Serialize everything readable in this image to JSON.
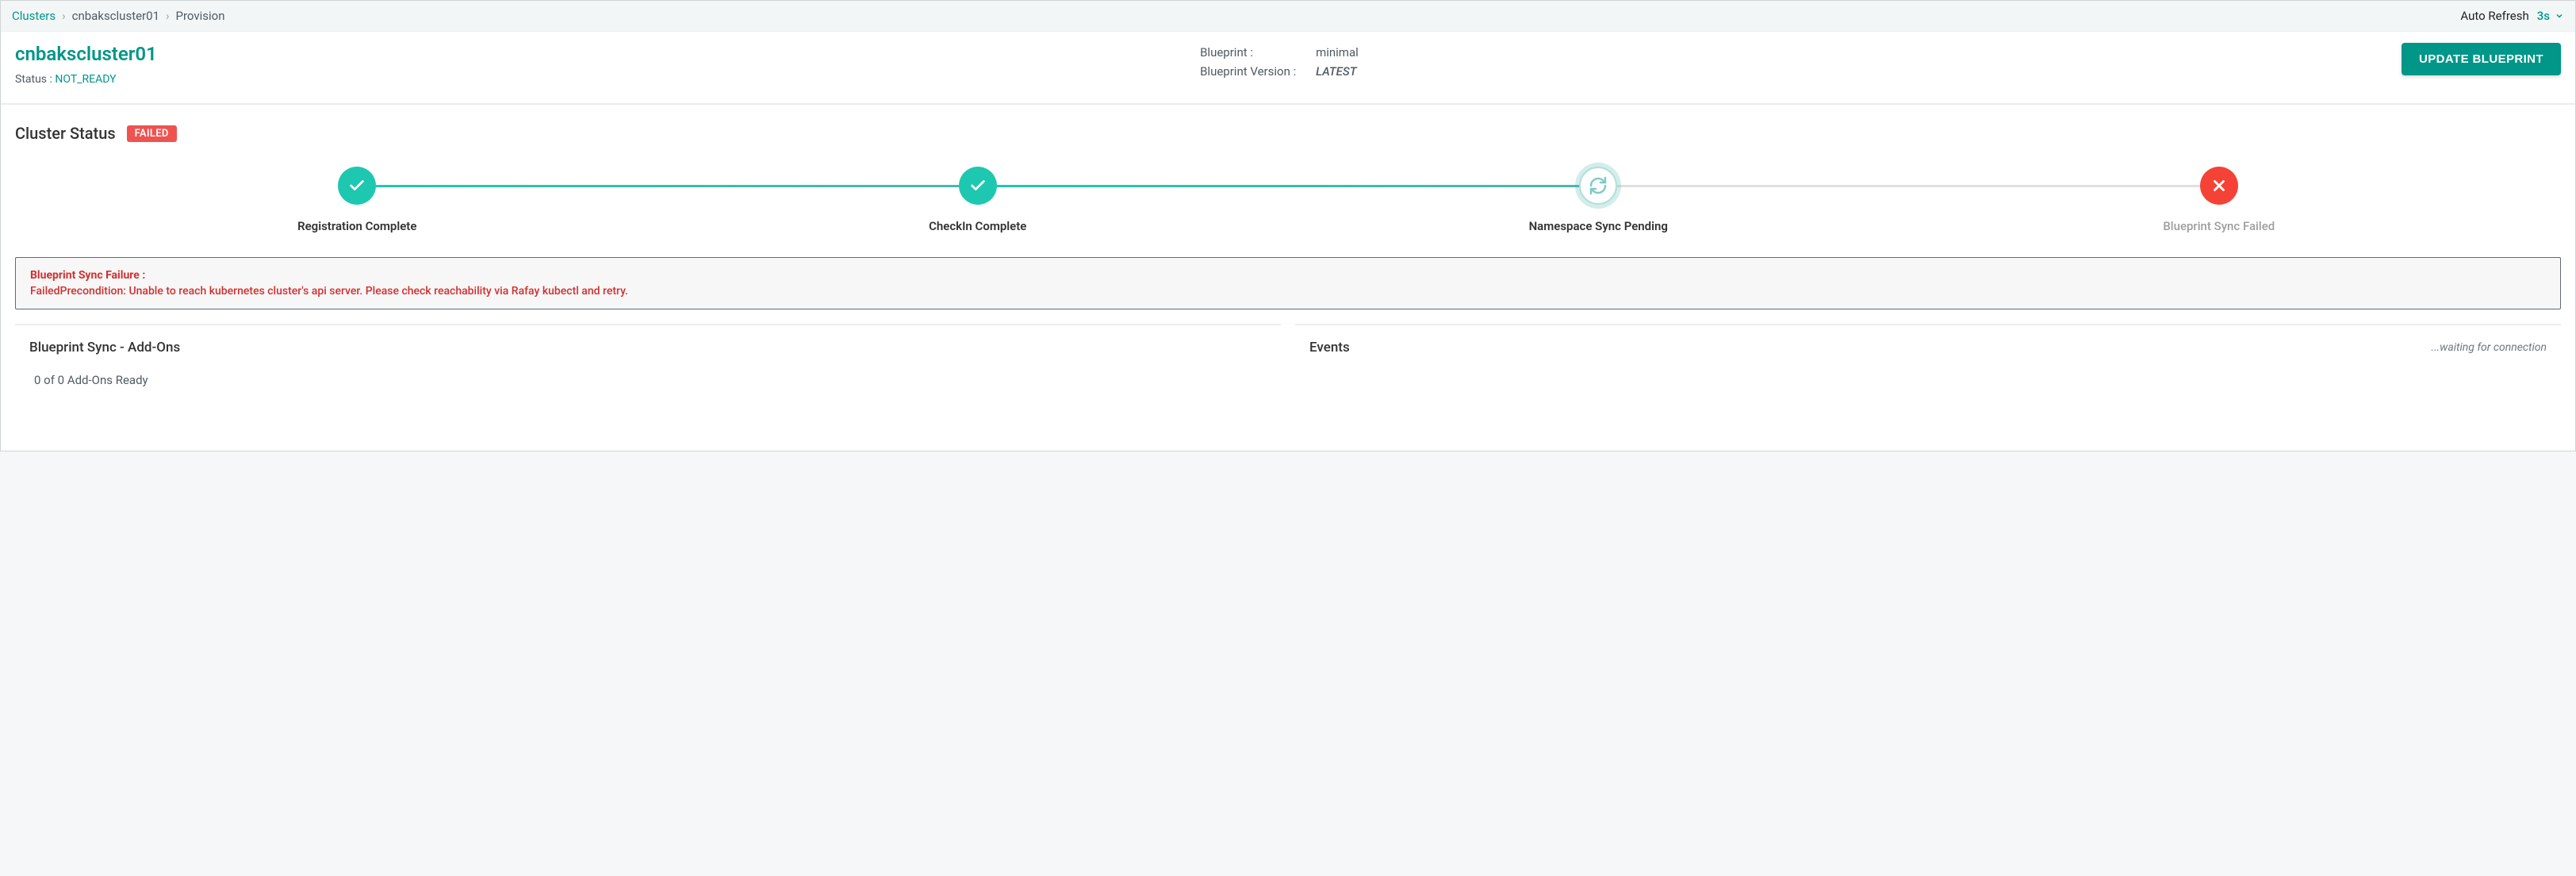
{
  "breadcrumb": {
    "root": "Clusters",
    "cluster": "cnbakscluster01",
    "leaf": "Provision",
    "sep": "›"
  },
  "autoRefresh": {
    "label": "Auto Refresh",
    "value": "3s"
  },
  "header": {
    "title": "cnbakscluster01",
    "statusLabel": "Status :",
    "statusValue": "NOT_READY",
    "blueprintLabel": "Blueprint :",
    "blueprintValue": "minimal",
    "blueprintVersionLabel": "Blueprint Version :",
    "blueprintVersionValue": "LATEST",
    "updateButton": "UPDATE BLUEPRINT"
  },
  "clusterStatus": {
    "title": "Cluster Status",
    "badge": "FAILED",
    "steps": {
      "s1": "Registration Complete",
      "s2": "CheckIn Complete",
      "s3": "Namespace Sync Pending",
      "s4": "Blueprint Sync Failed"
    },
    "error": {
      "title": "Blueprint Sync Failure :",
      "message": "FailedPrecondition: Unable to reach kubernetes cluster's api server. Please check reachability via Rafay kubectl and retry."
    }
  },
  "addons": {
    "title": "Blueprint Sync - Add-Ons",
    "summary": "0 of 0 Add-Ons Ready"
  },
  "events": {
    "title": "Events",
    "waiting": "...waiting for connection"
  }
}
